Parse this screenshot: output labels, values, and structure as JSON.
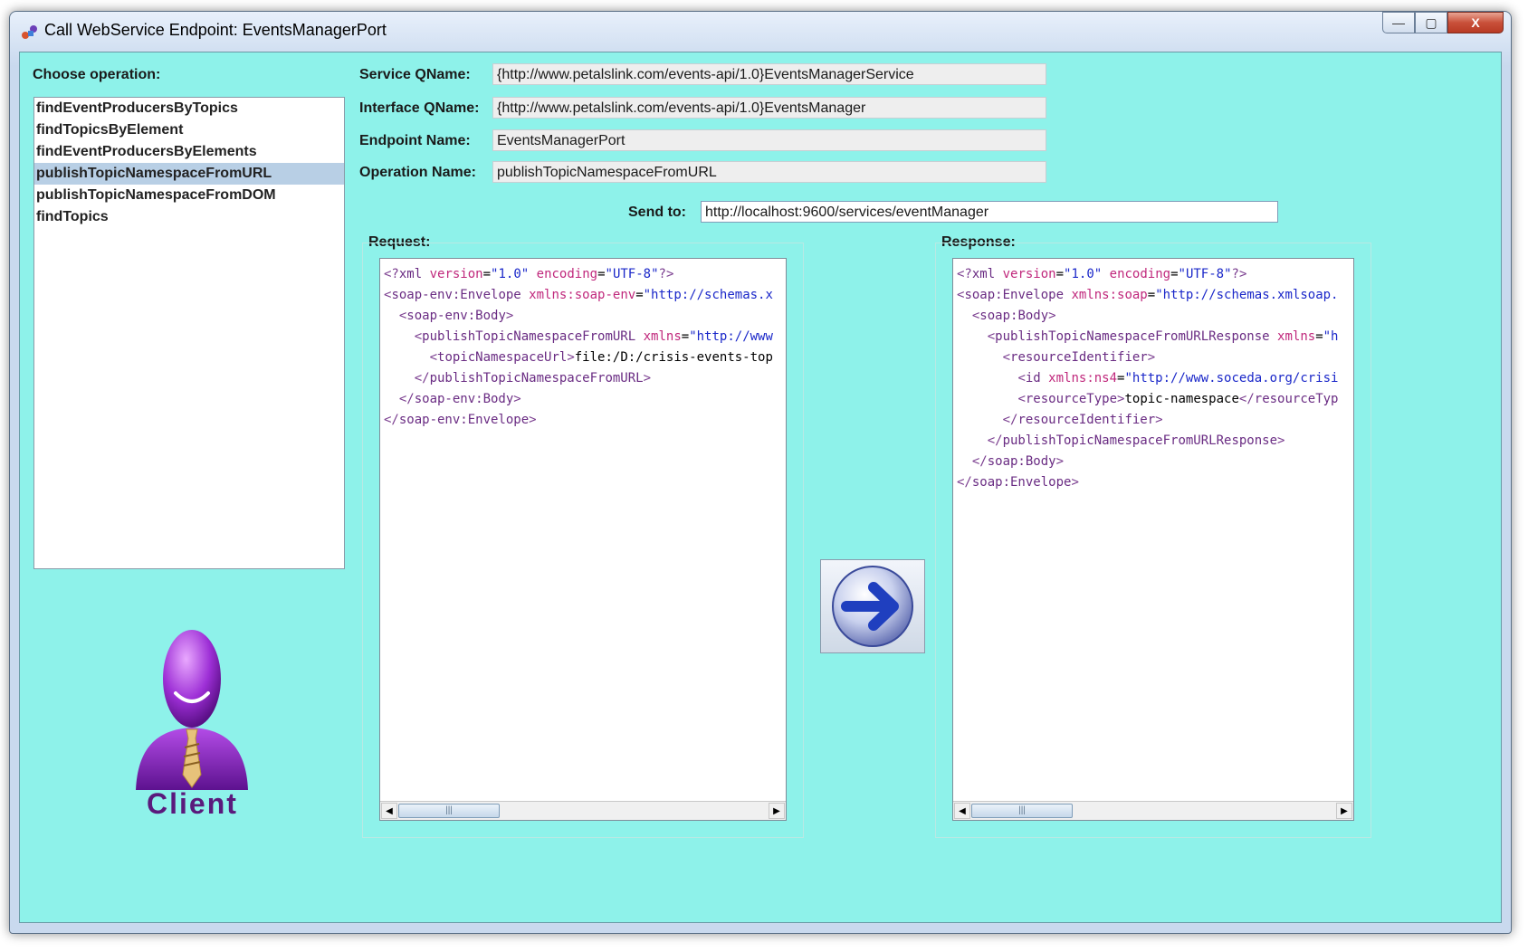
{
  "window": {
    "title": "Call WebService Endpoint: EventsManagerPort",
    "buttons": {
      "minimize": "—",
      "maximize": "▢",
      "close": "X"
    }
  },
  "operations": {
    "label": "Choose operation:",
    "items": [
      "findEventProducersByTopics",
      "findTopicsByElement",
      "findEventProducersByElements",
      "publishTopicNamespaceFromURL",
      "publishTopicNamespaceFromDOM",
      "findTopics"
    ],
    "selected": "publishTopicNamespaceFromURL"
  },
  "fields": {
    "service_qname_label": "Service QName:",
    "service_qname": "{http://www.petalslink.com/events-api/1.0}EventsManagerService",
    "interface_qname_label": "Interface QName:",
    "interface_qname": "{http://www.petalslink.com/events-api/1.0}EventsManager",
    "endpoint_name_label": "Endpoint Name:",
    "endpoint_name": "EventsManagerPort",
    "operation_name_label": "Operation Name:",
    "operation_name": "publishTopicNamespaceFromURL",
    "send_to_label": "Send to:",
    "send_to": "http://localhost:9600/services/eventManager"
  },
  "request": {
    "label": "Request:",
    "lines": [
      "<?xml version=\"1.0\" encoding=\"UTF-8\"?>",
      "<soap-env:Envelope xmlns:soap-env=\"http://schemas.x",
      "  <soap-env:Body>",
      "    <publishTopicNamespaceFromURL xmlns=\"http://www",
      "      <topicNamespaceUrl>file:/D:/crisis-events-top",
      "    </publishTopicNamespaceFromURL>",
      "  </soap-env:Body>",
      "</soap-env:Envelope>"
    ]
  },
  "response": {
    "label": "Response:",
    "lines": [
      "<?xml version=\"1.0\" encoding=\"UTF-8\"?>",
      "<soap:Envelope xmlns:soap=\"http://schemas.xmlsoap.",
      "  <soap:Body>",
      "    <publishTopicNamespaceFromURLResponse xmlns=\"h",
      "      <resourceIdentifier>",
      "        <id xmlns:ns4=\"http://www.soceda.org/crisi",
      "        <resourceType>topic-namespace</resourceTyp",
      "      </resourceIdentifier>",
      "    </publishTopicNamespaceFromURLResponse>",
      "  </soap:Body>",
      "</soap:Envelope>"
    ]
  },
  "client": {
    "label": "Client"
  },
  "colors": {
    "panel_bg": "#8ef2ea",
    "selection": "#b8cfe5",
    "send_arrow": "#1f3fbf"
  }
}
